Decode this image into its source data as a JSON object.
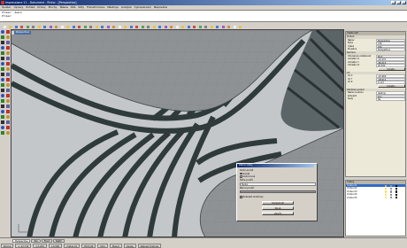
{
  "window": {
    "title": "Impressione 11 - Dokument - Rhino - [Perspective]"
  },
  "menu": [
    "Soubor",
    "Úpravy",
    "Pohled",
    "Křivky",
    "Plochy",
    "Tělesa",
    "Sítě",
    "Kóty",
    "Transformace",
    "Nástroje",
    "Analýza",
    "Vykreslování",
    "Nápověda"
  ],
  "command": {
    "lines": [
      "Příkaz: _Zebra",
      "Příkaz:"
    ]
  },
  "viewport": {
    "label": "Perspective"
  },
  "zebra_dialog": {
    "title": "Zebra volby",
    "direction_label": "Směr pruhů",
    "opt_vertical": "Svislé",
    "opt_horizontal": "Vodorovné",
    "stripe_size_label": "Šířka pruhů",
    "stripe_size_value": "Tenké",
    "color_label": "Barva pruhů",
    "show_iso_label": "Zobrazit izokřivky",
    "btn_adjust": "Upravit síť",
    "btn_new": "Nová",
    "btn_close": "Zavřít"
  },
  "properties": {
    "header": "Vlastnosti",
    "sec_view": "Pohled",
    "rows_view": [
      [
        "Název",
        "Perspective"
      ],
      [
        "Šířka",
        "376"
      ],
      [
        "Výška",
        "234"
      ],
      [
        "Projekce",
        "Perspektiva"
      ]
    ],
    "sec_camera": "Kamera",
    "rows_camera": [
      [
        "Ohnisková vzdálenost",
        "50.0"
      ],
      [
        "Umístění X",
        "-43.107"
      ],
      [
        "Umístění Y",
        "-80.615"
      ],
      [
        "Umístění Z",
        "26.590"
      ]
    ],
    "place_btn": "Umístit...",
    "sec_target": "Cíl",
    "rows_target": [
      [
        "Cíl X",
        "-16.969"
      ],
      [
        "Cíl Y",
        "-38.612"
      ],
      [
        "Cíl Z",
        "4.113"
      ]
    ],
    "sec_bg": "Obrázek pozadí",
    "rows_bg": [
      [
        "Název souboru",
        "(žádný)"
      ],
      [
        "Zobrazit",
        "Ano"
      ],
      [
        "Šedý",
        "Ne"
      ]
    ]
  },
  "layers": {
    "header": "Vrstvy",
    "rows": [
      {
        "name": "Vrstva 01",
        "color": "#000000",
        "selected": true
      },
      {
        "name": "Vrstva 02",
        "color": "#ff0000",
        "selected": false
      },
      {
        "name": "Vrstva 03",
        "color": "#0000ff",
        "selected": false
      },
      {
        "name": "Vrstva 04",
        "color": "#00aa00",
        "selected": false
      },
      {
        "name": "Vrstva 05",
        "color": "#000000",
        "selected": false
      }
    ]
  },
  "viewport_tabs": [
    "Perspective",
    "Top",
    "Front",
    "Right"
  ],
  "status": [
    "Rovina",
    "x -12.714",
    "y 0.254",
    "z 0.000",
    "Vrstva 01",
    "Přichytit",
    "Orto",
    "Planar",
    "Osnap",
    "Záznam historie"
  ]
}
